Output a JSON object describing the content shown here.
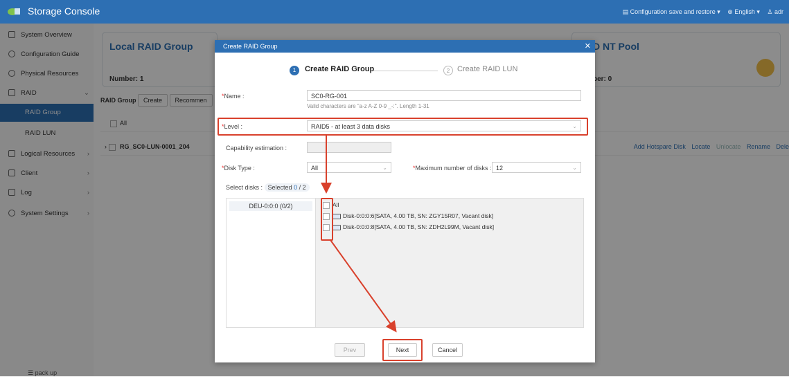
{
  "app": {
    "title": "Storage Console"
  },
  "header": {
    "config_menu": "Configuration save and restore",
    "language": "English",
    "user": "adr"
  },
  "sidebar": {
    "items": [
      {
        "label": "System Overview"
      },
      {
        "label": "Configuration Guide"
      },
      {
        "label": "Physical Resources"
      },
      {
        "label": "RAID"
      },
      {
        "label": "RAID Group"
      },
      {
        "label": "RAID LUN"
      },
      {
        "label": "Logical Resources"
      },
      {
        "label": "Client"
      },
      {
        "label": "Log"
      },
      {
        "label": "System Settings"
      }
    ],
    "pack_up": "pack up"
  },
  "main": {
    "local_card": {
      "title": "Local RAID Group",
      "number": "Number: 1"
    },
    "nt_card": {
      "title": "D NT Pool",
      "number": "ber: 0"
    },
    "toolbar": {
      "label": "RAID Group",
      "create": "Create",
      "recommend": "Recommen"
    },
    "row_all": "All",
    "row_rg": "RG_SC0-LUN-0001_204",
    "row_actions": [
      "Add Hotspare Disk",
      "Locate",
      "Unlocate",
      "Rename",
      "Dele"
    ]
  },
  "dialog": {
    "title": "Create RAID Group",
    "step1": {
      "num": "1",
      "label": "Create RAID Group"
    },
    "step2": {
      "num": "2",
      "label": "Create RAID LUN"
    },
    "name": {
      "label": "Name :",
      "value": "SC0-RG-001",
      "hint": "Valid characters are \"a-z A-Z 0-9 _-:\". Length 1-31"
    },
    "level": {
      "label": "Level :",
      "value": "RAID5 - at least 3 data disks"
    },
    "capability": {
      "label": "Capability estimation :"
    },
    "disk_type": {
      "label": "Disk Type :",
      "value": "All"
    },
    "max_disks": {
      "label": "Maximum number of disks :",
      "value": "12"
    },
    "select_disks": {
      "label": "Select disks :",
      "selected": "Selected",
      "count": "0",
      "total": "/ 2"
    },
    "dae": "DEU-0:0:0 (0/2)",
    "disks": [
      {
        "label": "All"
      },
      {
        "label": "Disk-0:0:0:6[SATA, 4.00 TB, SN: ZGY15R07, Vacant disk]"
      },
      {
        "label": "Disk-0:0:0:8[SATA, 4.00 TB, SN: ZDH2L99M, Vacant disk]"
      }
    ],
    "buttons": {
      "prev": "Prev",
      "next": "Next",
      "cancel": "Cancel"
    }
  },
  "colors": {
    "accent": "#2d6fb3",
    "annotation": "#d9412c"
  }
}
